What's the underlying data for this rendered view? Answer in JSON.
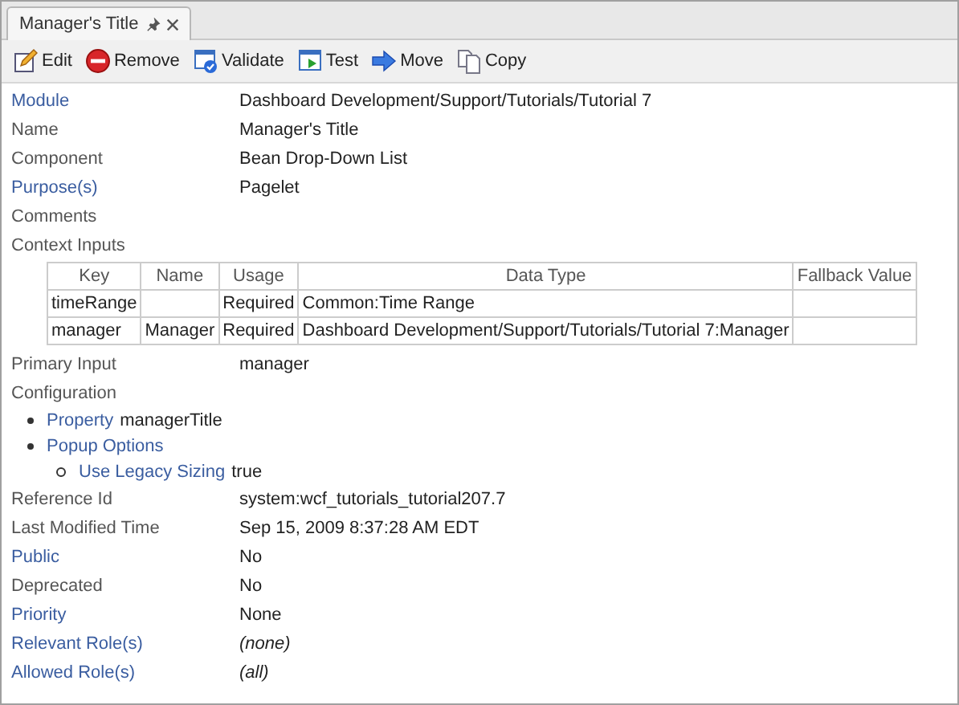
{
  "tab": {
    "title": "Manager's Title",
    "pinned": true
  },
  "toolbar": [
    {
      "kind": "edit",
      "label": "Edit"
    },
    {
      "kind": "remove",
      "label": "Remove"
    },
    {
      "kind": "validate",
      "label": "Validate"
    },
    {
      "kind": "test",
      "label": "Test"
    },
    {
      "kind": "move",
      "label": "Move"
    },
    {
      "kind": "copy",
      "label": "Copy"
    }
  ],
  "properties": [
    {
      "kind": "field",
      "label": "Module",
      "link": true,
      "value": "Dashboard Development/Support/Tutorials/Tutorial 7"
    },
    {
      "kind": "field",
      "label": "Name",
      "link": false,
      "value": "Manager's Title"
    },
    {
      "kind": "field",
      "label": "Component",
      "link": false,
      "value": "Bean Drop-Down List"
    },
    {
      "kind": "field",
      "label": "Purpose(s)",
      "link": true,
      "value": "Pagelet"
    },
    {
      "kind": "field",
      "label": "Comments",
      "link": false
    },
    {
      "kind": "table",
      "label": "Context Inputs",
      "columns": [
        "Key",
        "Name",
        "Usage",
        "Data Type",
        "Fallback Value"
      ],
      "rows": [
        [
          "timeRange",
          "",
          "Required",
          "Common:Time Range",
          ""
        ],
        [
          "manager",
          "Manager",
          "Required",
          "Dashboard Development/Support/Tutorials/Tutorial 7:Manager",
          ""
        ]
      ]
    },
    {
      "kind": "field",
      "label": "Primary Input",
      "link": false,
      "value": "manager"
    },
    {
      "kind": "tree",
      "label": "Configuration",
      "items": [
        {
          "label": "Property",
          "value": "managerTitle"
        },
        {
          "label": "Popup Options",
          "children": [
            {
              "label": "Use Legacy Sizing",
              "value": "true"
            }
          ]
        }
      ]
    },
    {
      "kind": "field",
      "label": "Reference Id",
      "link": false,
      "value": "system:wcf_tutorials_tutorial207.7"
    },
    {
      "kind": "field",
      "label": "Last Modified Time",
      "link": false,
      "value": "Sep 15, 2009 8:37:28 AM EDT"
    },
    {
      "kind": "field",
      "label": "Public",
      "link": true,
      "value": "No"
    },
    {
      "kind": "field",
      "label": "Deprecated",
      "link": false,
      "value": "No"
    },
    {
      "kind": "field",
      "label": "Priority",
      "link": true,
      "value": "None"
    },
    {
      "kind": "field",
      "label": "Relevant Role(s)",
      "link": true,
      "value": "(none)",
      "italic": true
    },
    {
      "kind": "field",
      "label": "Allowed Role(s)",
      "link": true,
      "value": "(all)",
      "italic": true
    }
  ]
}
